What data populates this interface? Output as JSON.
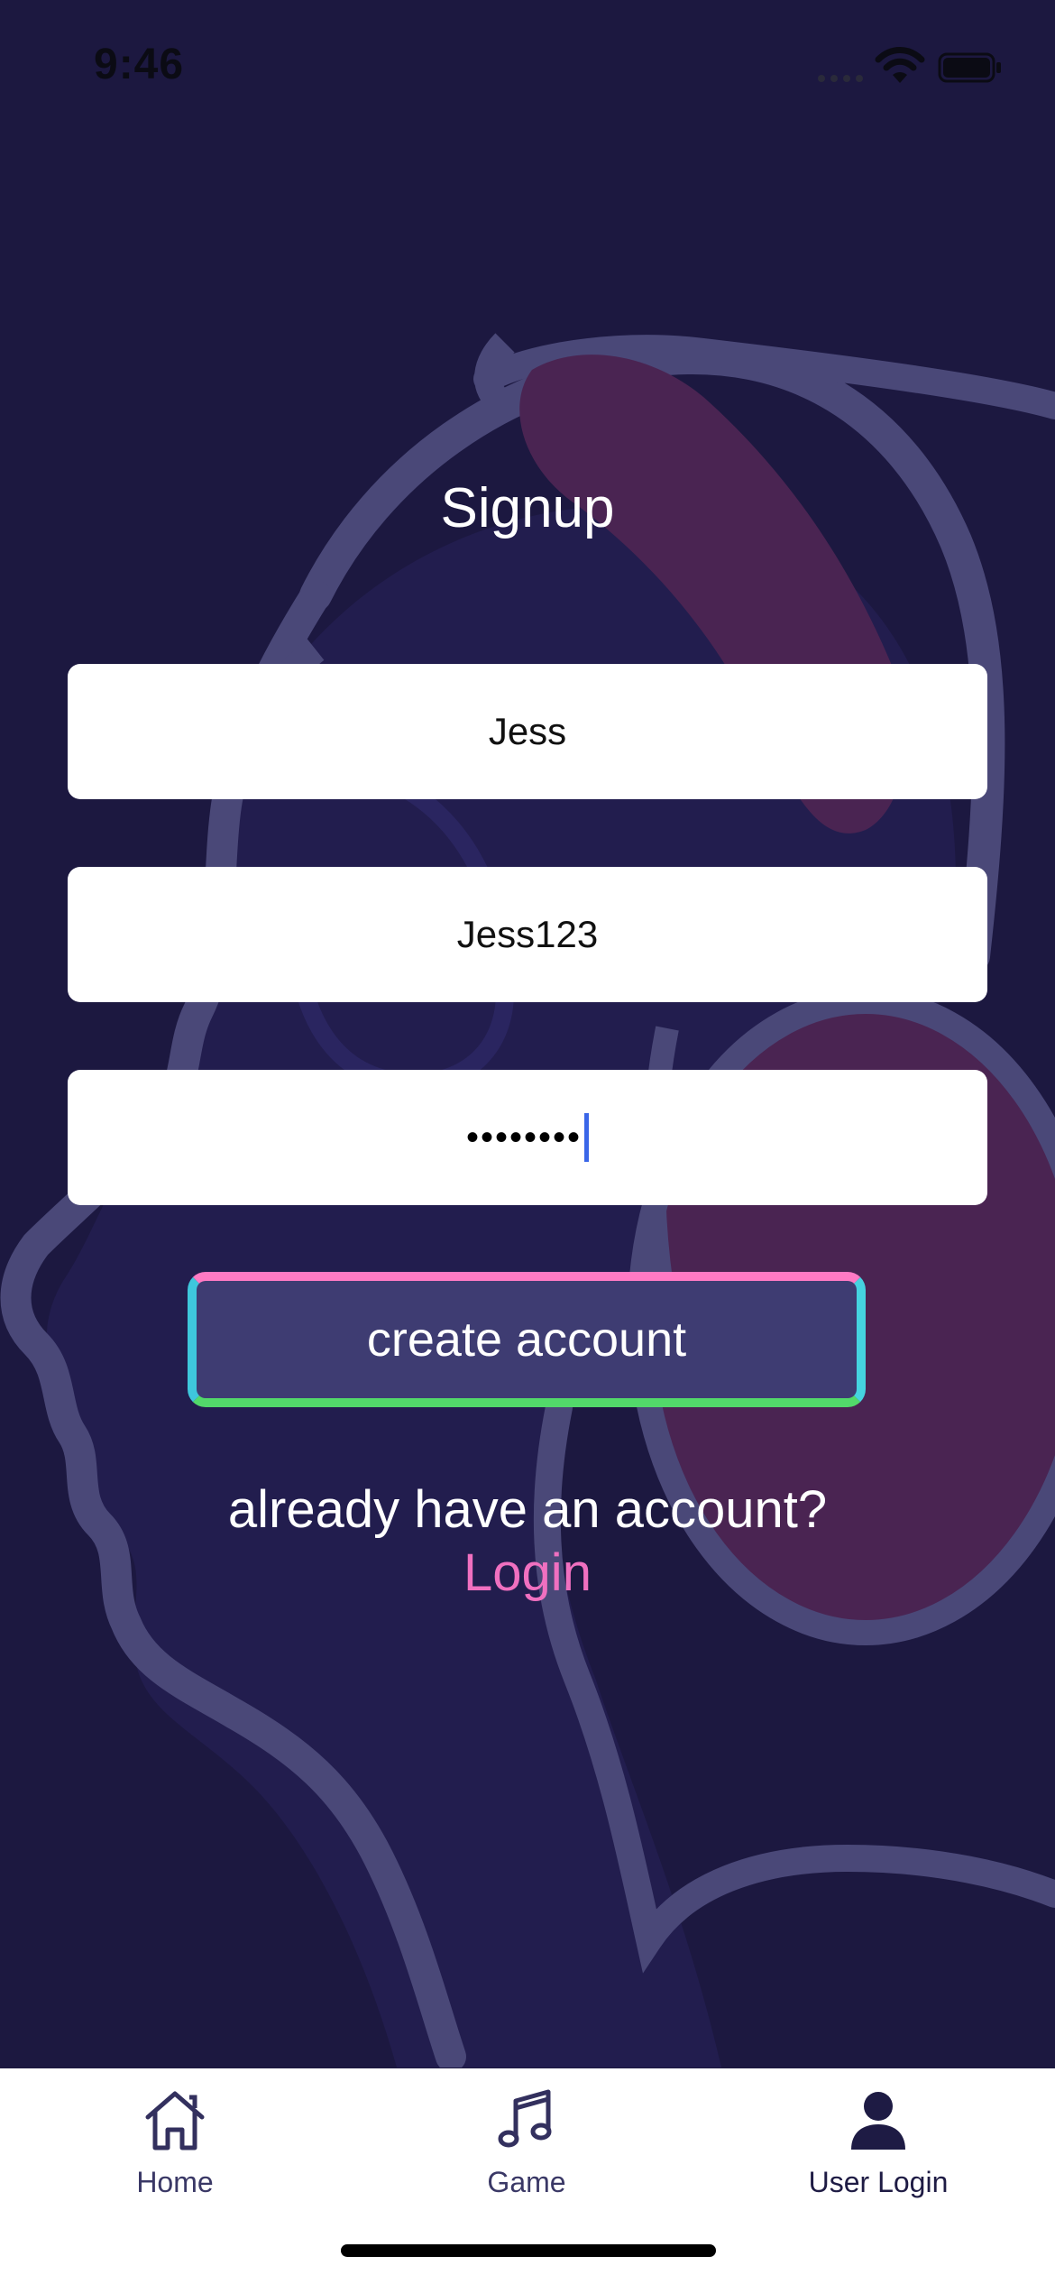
{
  "status_bar": {
    "time": "9:46"
  },
  "signup": {
    "title": "Signup",
    "name_value": "Jess",
    "username_value": "Jess123",
    "password_masked": "••••••••"
  },
  "create_button": {
    "label": "create account"
  },
  "login_prompt": {
    "text": "already have an account?",
    "link": "Login"
  },
  "tab_bar": {
    "items": [
      {
        "label": "Home",
        "icon": "home-icon"
      },
      {
        "label": "Game",
        "icon": "music-note-icon"
      },
      {
        "label": "User Login",
        "icon": "user-icon"
      }
    ],
    "active_index": 2
  },
  "colors": {
    "background": "#1c1840",
    "button_fill": "#3e3c72",
    "link": "#f070c0",
    "border_pink": "#ff7ac4",
    "border_cyan": "#45d3e0",
    "border_green": "#52d96a"
  }
}
